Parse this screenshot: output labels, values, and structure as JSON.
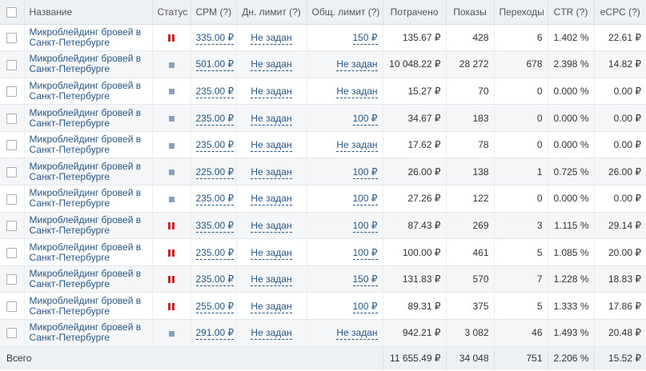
{
  "columns": {
    "name": "Название",
    "status": "Статус",
    "cpm": "CPM (?)",
    "day_limit": "Дн. лимит (?)",
    "total_limit": "Общ. лимит (?)",
    "spent": "Потрачено",
    "views": "Показы",
    "clicks": "Переходы",
    "ctr": "CTR (?)",
    "ecpc": "eCPC (?)"
  },
  "colors": {
    "link": "#2a5885",
    "paused": "#c62828",
    "stopped": "#8a9fb8",
    "header_bg": "#eef1f4",
    "row_alt_bg": "#f4f6f8"
  },
  "rows": [
    {
      "name": "Микроблейдинг бровей в Санкт-Петербурге",
      "status": "paused",
      "cpm": "335.00 ₽",
      "day_limit": "Не задан",
      "total_limit": "150 ₽",
      "spent": "135.67 ₽",
      "views": "428",
      "clicks": "6",
      "ctr": "1.402 %",
      "ecpc": "22.61 ₽"
    },
    {
      "name": "Микроблейдинг бровей в Санкт-Петербурге",
      "status": "stopped",
      "cpm": "501.00 ₽",
      "day_limit": "Не задан",
      "total_limit": "Не задан",
      "spent": "10 048.22 ₽",
      "views": "28 272",
      "clicks": "678",
      "ctr": "2.398 %",
      "ecpc": "14.82 ₽"
    },
    {
      "name": "Микроблейдинг бровей в Санкт-Петербурге",
      "status": "stopped",
      "cpm": "235.00 ₽",
      "day_limit": "Не задан",
      "total_limit": "Не задан",
      "spent": "15.27 ₽",
      "views": "70",
      "clicks": "0",
      "ctr": "0.000 %",
      "ecpc": "0.00 ₽"
    },
    {
      "name": "Микроблейдинг бровей в Санкт-Петербурге",
      "status": "stopped",
      "cpm": "235.00 ₽",
      "day_limit": "Не задан",
      "total_limit": "100 ₽",
      "spent": "34.67 ₽",
      "views": "183",
      "clicks": "0",
      "ctr": "0.000 %",
      "ecpc": "0.00 ₽"
    },
    {
      "name": "Микроблейдинг бровей в Санкт-Петербурге",
      "status": "stopped",
      "cpm": "235.00 ₽",
      "day_limit": "Не задан",
      "total_limit": "Не задан",
      "spent": "17.62 ₽",
      "views": "78",
      "clicks": "0",
      "ctr": "0.000 %",
      "ecpc": "0.00 ₽"
    },
    {
      "name": "Микроблейдинг бровей в Санкт-Петербурге",
      "status": "stopped",
      "cpm": "225.00 ₽",
      "day_limit": "Не задан",
      "total_limit": "100 ₽",
      "spent": "26.00 ₽",
      "views": "138",
      "clicks": "1",
      "ctr": "0.725 %",
      "ecpc": "26.00 ₽"
    },
    {
      "name": "Микроблейдинг бровей в Санкт-Петербурге",
      "status": "stopped",
      "cpm": "235.00 ₽",
      "day_limit": "Не задан",
      "total_limit": "100 ₽",
      "spent": "27.26 ₽",
      "views": "122",
      "clicks": "0",
      "ctr": "0.000 %",
      "ecpc": "0.00 ₽"
    },
    {
      "name": "Микроблейдинг бровей в Санкт-Петербурге",
      "status": "paused",
      "cpm": "335.00 ₽",
      "day_limit": "Не задан",
      "total_limit": "100 ₽",
      "spent": "87.43 ₽",
      "views": "269",
      "clicks": "3",
      "ctr": "1.115 %",
      "ecpc": "29.14 ₽"
    },
    {
      "name": "Микроблейдинг бровей в Санкт-Петербурге",
      "status": "paused",
      "cpm": "235.00 ₽",
      "day_limit": "Не задан",
      "total_limit": "100 ₽",
      "spent": "100.00 ₽",
      "views": "461",
      "clicks": "5",
      "ctr": "1.085 %",
      "ecpc": "20.00 ₽"
    },
    {
      "name": "Микроблейдинг бровей в Санкт-Петербурге",
      "status": "paused",
      "cpm": "235.00 ₽",
      "day_limit": "Не задан",
      "total_limit": "150 ₽",
      "spent": "131.83 ₽",
      "views": "570",
      "clicks": "7",
      "ctr": "1.228 %",
      "ecpc": "18.83 ₽"
    },
    {
      "name": "Микроблейдинг бровей в Санкт-Петербурге",
      "status": "paused",
      "cpm": "255.00 ₽",
      "day_limit": "Не задан",
      "total_limit": "100 ₽",
      "spent": "89.31 ₽",
      "views": "375",
      "clicks": "5",
      "ctr": "1.333 %",
      "ecpc": "17.86 ₽"
    },
    {
      "name": "Микроблейдинг бровей в Санкт-Петербурге",
      "status": "stopped",
      "cpm": "291.00 ₽",
      "day_limit": "Не задан",
      "total_limit": "Не задан",
      "spent": "942.21 ₽",
      "views": "3 082",
      "clicks": "46",
      "ctr": "1.493 %",
      "ecpc": "20.48 ₽"
    }
  ],
  "totals": {
    "label": "Всего",
    "spent": "11 655.49 ₽",
    "views": "34 048",
    "clicks": "751",
    "ctr": "2.206 %",
    "ecpc": "15.52 ₽"
  }
}
